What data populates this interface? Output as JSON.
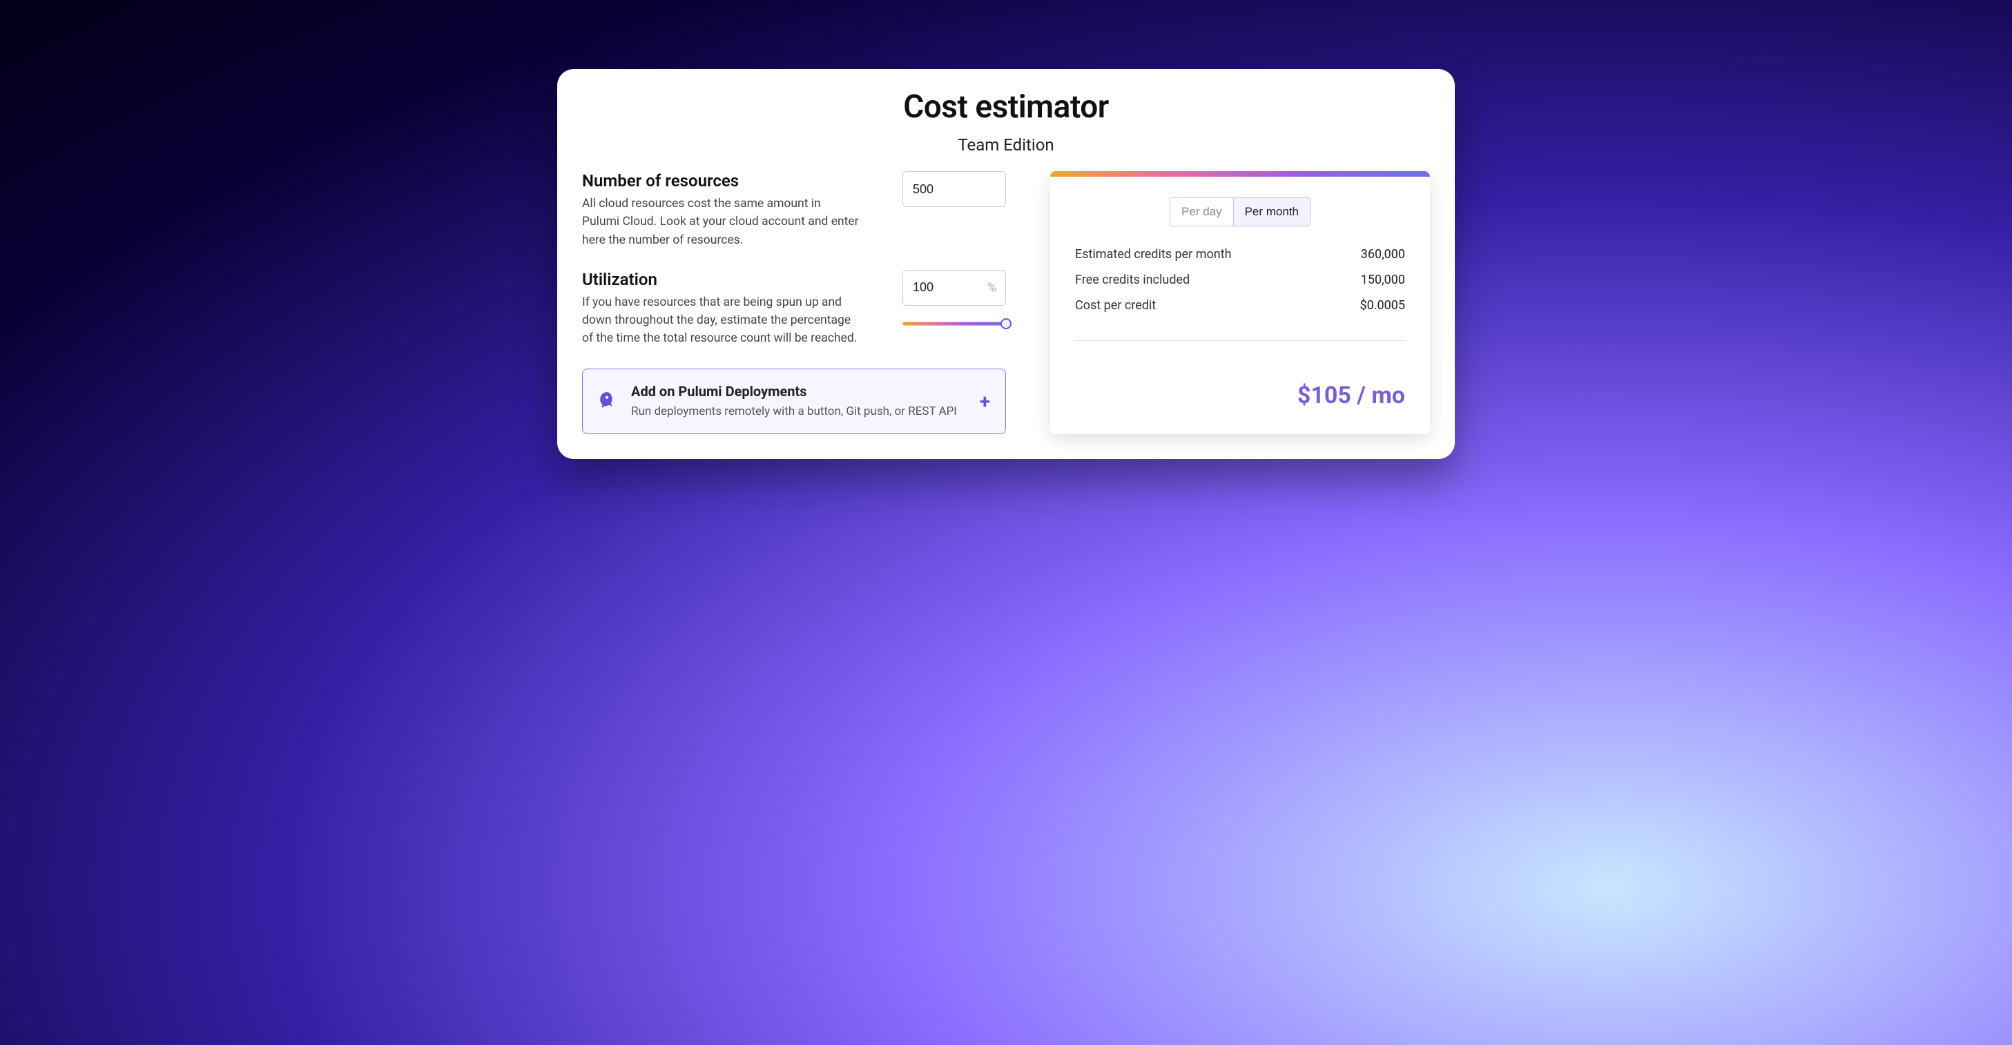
{
  "header": {
    "title": "Cost estimator",
    "subtitle": "Team Edition"
  },
  "resources": {
    "title": "Number of resources",
    "description": "All cloud resources cost the same amount in Pulumi Cloud. Look at your cloud account and enter here the number of resources.",
    "value": "500"
  },
  "utilization": {
    "title": "Utilization",
    "description": "If you have resources that are being spun up and down throughout the day, estimate the percentage of the time the total resource count will be reached.",
    "value": "100",
    "suffix": "%"
  },
  "addon": {
    "title": "Add on Pulumi Deployments",
    "description": "Run deployments remotely with a button, Git push, or REST API"
  },
  "summary": {
    "toggle": {
      "per_day": "Per day",
      "per_month": "Per month"
    },
    "lines": [
      {
        "label": "Estimated credits per month",
        "value": "360,000"
      },
      {
        "label": "Free credits included",
        "value": "150,000"
      },
      {
        "label": "Cost per credit",
        "value": "$0.0005"
      }
    ],
    "total": "$105 / mo"
  }
}
